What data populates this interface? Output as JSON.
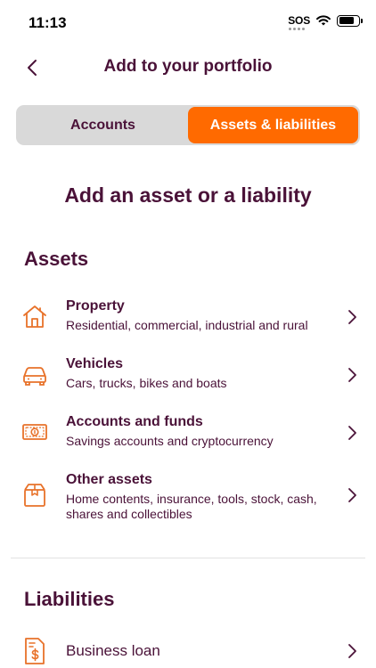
{
  "status_bar": {
    "time": "11:13",
    "sos": "SOS",
    "battery_level_percent": 80
  },
  "nav": {
    "title": "Add to your portfolio",
    "back_icon": "chevron-left-icon"
  },
  "segments": [
    {
      "label": "Accounts",
      "active": false
    },
    {
      "label": "Assets & liabilities",
      "active": true
    }
  ],
  "heading": "Add an asset or a liability",
  "assets": {
    "title": "Assets",
    "items": [
      {
        "icon": "house-icon",
        "title": "Property",
        "subtitle": "Residential, commercial, industrial and rural"
      },
      {
        "icon": "car-icon",
        "title": "Vehicles",
        "subtitle": "Cars, trucks, bikes and boats"
      },
      {
        "icon": "banknote-icon",
        "title": "Accounts and funds",
        "subtitle": "Savings accounts and cryptocurrency"
      },
      {
        "icon": "box-icon",
        "title": "Other assets",
        "subtitle": "Home contents, insurance, tools, stock, cash, shares and collectibles"
      }
    ]
  },
  "liabilities": {
    "title": "Liabilities",
    "items": [
      {
        "icon": "document-dollar-icon",
        "title": "Business loan"
      }
    ]
  },
  "colors": {
    "accent": "#ff6a00",
    "primary_text": "#4a1238",
    "segment_bg": "#d9d9d9",
    "icon": "#e8722a"
  }
}
